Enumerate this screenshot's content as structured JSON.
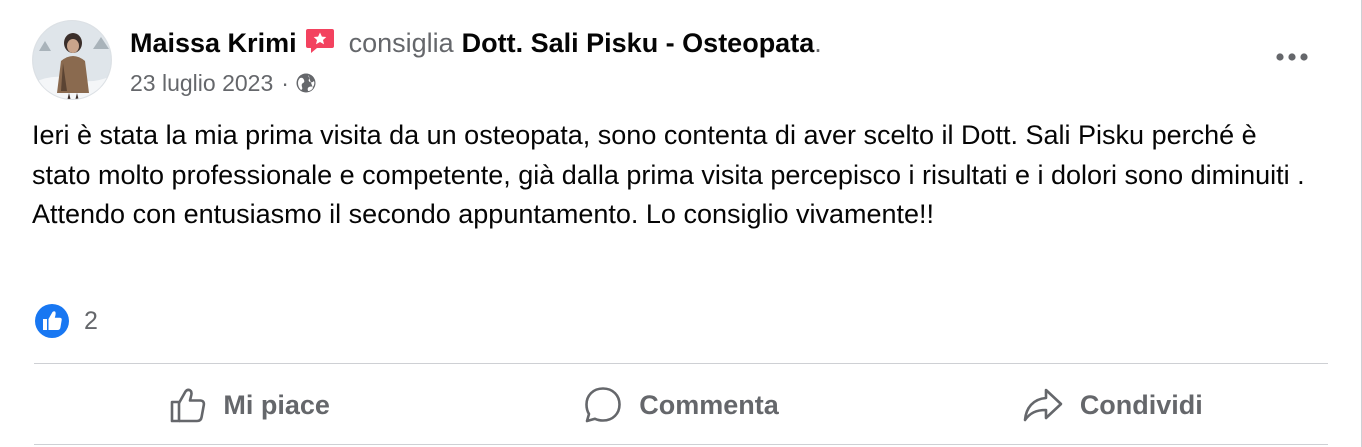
{
  "post": {
    "author": "Maissa Krimi",
    "verb": "consiglia",
    "target": "Dott. Sali Pisku - Osteopata",
    "period": ".",
    "date": "23 luglio 2023",
    "separator": "·",
    "privacy_icon": "globe-icon",
    "badge_icon": "recommend-star-icon",
    "more_icon": "more-options-icon",
    "text": "Ieri è stata la mia prima visita da un osteopata, sono contenta di aver scelto il Dott. Sali Pisku perché è stato molto professionale e competente, già dalla prima visita percepisco i risultati e i dolori sono diminuiti . Attendo con entusiasmo il secondo appuntamento. Lo consiglio vivamente!!"
  },
  "reactions": {
    "icon": "like-reaction-icon",
    "count": "2"
  },
  "actions": {
    "like_label": "Mi piace",
    "comment_label": "Commenta",
    "share_label": "Condividi"
  },
  "colors": {
    "text_primary": "#050505",
    "text_secondary": "#65676b",
    "like_blue": "#1877f2",
    "badge_pink": "#f3425f",
    "divider": "#ced0d4"
  }
}
